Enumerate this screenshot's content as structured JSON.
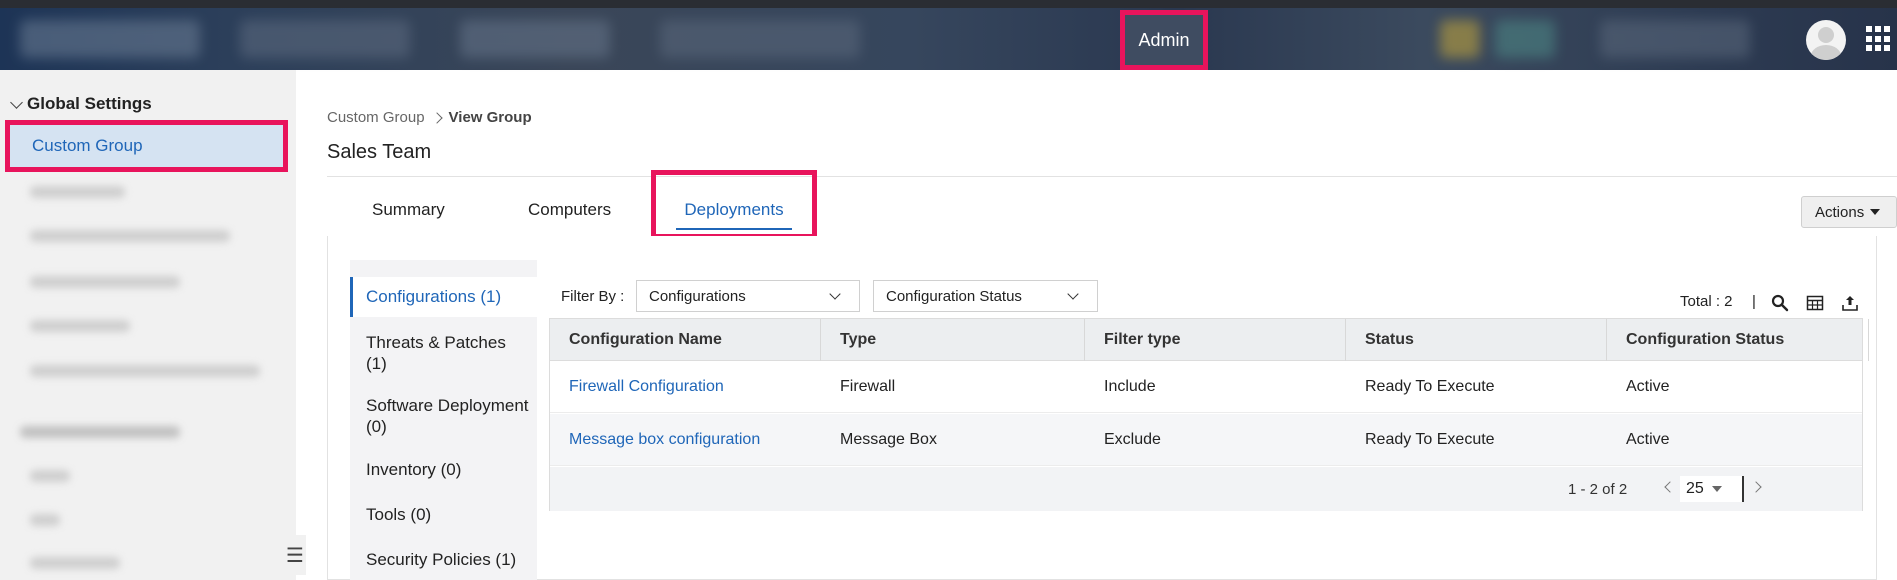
{
  "header": {
    "admin_label": "Admin"
  },
  "sidebar": {
    "section_title": "Global Settings",
    "active_item": "Custom Group"
  },
  "breadcrumb": {
    "parent": "Custom Group",
    "current": "View Group"
  },
  "page": {
    "title": "Sales Team"
  },
  "tabs": [
    {
      "label": "Summary"
    },
    {
      "label": "Computers"
    },
    {
      "label": "Deployments"
    }
  ],
  "actions": {
    "label": "Actions"
  },
  "left_menu": [
    {
      "label": "Configurations (1)"
    },
    {
      "label": "Threats & Patches (1)"
    },
    {
      "label": "Software Deployment (0)"
    },
    {
      "label": "Inventory (0)"
    },
    {
      "label": "Tools (0)"
    },
    {
      "label": "Security Policies (1)"
    }
  ],
  "filter": {
    "label": "Filter By :",
    "selected_type": "Configurations",
    "status_select": "Configuration Status"
  },
  "toolbar": {
    "total": "Total : 2",
    "separator": "|"
  },
  "table": {
    "columns": [
      "Configuration Name",
      "Type",
      "Filter type",
      "Status",
      "Configuration Status"
    ],
    "rows": [
      [
        "Firewall Configuration",
        "Firewall",
        "Include",
        "Ready To Execute",
        "Active"
      ],
      [
        "Message box configuration",
        "Message Box",
        "Exclude",
        "Ready To Execute",
        "Active"
      ]
    ]
  },
  "pagination": {
    "range": "1 - 2 of 2",
    "page_size": "25"
  },
  "colors": {
    "accent": "#1f66b8",
    "highlight_border": "#e8145c",
    "topbar": "#36465d"
  }
}
